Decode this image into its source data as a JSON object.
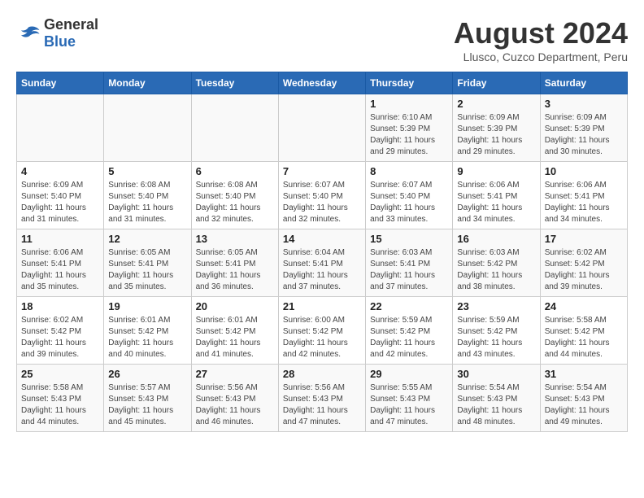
{
  "header": {
    "logo_general": "General",
    "logo_blue": "Blue",
    "month_year": "August 2024",
    "location": "Llusco, Cuzco Department, Peru"
  },
  "days_of_week": [
    "Sunday",
    "Monday",
    "Tuesday",
    "Wednesday",
    "Thursday",
    "Friday",
    "Saturday"
  ],
  "weeks": [
    [
      {
        "day": "",
        "info": ""
      },
      {
        "day": "",
        "info": ""
      },
      {
        "day": "",
        "info": ""
      },
      {
        "day": "",
        "info": ""
      },
      {
        "day": "1",
        "info": "Sunrise: 6:10 AM\nSunset: 5:39 PM\nDaylight: 11 hours\nand 29 minutes."
      },
      {
        "day": "2",
        "info": "Sunrise: 6:09 AM\nSunset: 5:39 PM\nDaylight: 11 hours\nand 29 minutes."
      },
      {
        "day": "3",
        "info": "Sunrise: 6:09 AM\nSunset: 5:39 PM\nDaylight: 11 hours\nand 30 minutes."
      }
    ],
    [
      {
        "day": "4",
        "info": "Sunrise: 6:09 AM\nSunset: 5:40 PM\nDaylight: 11 hours\nand 31 minutes."
      },
      {
        "day": "5",
        "info": "Sunrise: 6:08 AM\nSunset: 5:40 PM\nDaylight: 11 hours\nand 31 minutes."
      },
      {
        "day": "6",
        "info": "Sunrise: 6:08 AM\nSunset: 5:40 PM\nDaylight: 11 hours\nand 32 minutes."
      },
      {
        "day": "7",
        "info": "Sunrise: 6:07 AM\nSunset: 5:40 PM\nDaylight: 11 hours\nand 32 minutes."
      },
      {
        "day": "8",
        "info": "Sunrise: 6:07 AM\nSunset: 5:40 PM\nDaylight: 11 hours\nand 33 minutes."
      },
      {
        "day": "9",
        "info": "Sunrise: 6:06 AM\nSunset: 5:41 PM\nDaylight: 11 hours\nand 34 minutes."
      },
      {
        "day": "10",
        "info": "Sunrise: 6:06 AM\nSunset: 5:41 PM\nDaylight: 11 hours\nand 34 minutes."
      }
    ],
    [
      {
        "day": "11",
        "info": "Sunrise: 6:06 AM\nSunset: 5:41 PM\nDaylight: 11 hours\nand 35 minutes."
      },
      {
        "day": "12",
        "info": "Sunrise: 6:05 AM\nSunset: 5:41 PM\nDaylight: 11 hours\nand 35 minutes."
      },
      {
        "day": "13",
        "info": "Sunrise: 6:05 AM\nSunset: 5:41 PM\nDaylight: 11 hours\nand 36 minutes."
      },
      {
        "day": "14",
        "info": "Sunrise: 6:04 AM\nSunset: 5:41 PM\nDaylight: 11 hours\nand 37 minutes."
      },
      {
        "day": "15",
        "info": "Sunrise: 6:03 AM\nSunset: 5:41 PM\nDaylight: 11 hours\nand 37 minutes."
      },
      {
        "day": "16",
        "info": "Sunrise: 6:03 AM\nSunset: 5:42 PM\nDaylight: 11 hours\nand 38 minutes."
      },
      {
        "day": "17",
        "info": "Sunrise: 6:02 AM\nSunset: 5:42 PM\nDaylight: 11 hours\nand 39 minutes."
      }
    ],
    [
      {
        "day": "18",
        "info": "Sunrise: 6:02 AM\nSunset: 5:42 PM\nDaylight: 11 hours\nand 39 minutes."
      },
      {
        "day": "19",
        "info": "Sunrise: 6:01 AM\nSunset: 5:42 PM\nDaylight: 11 hours\nand 40 minutes."
      },
      {
        "day": "20",
        "info": "Sunrise: 6:01 AM\nSunset: 5:42 PM\nDaylight: 11 hours\nand 41 minutes."
      },
      {
        "day": "21",
        "info": "Sunrise: 6:00 AM\nSunset: 5:42 PM\nDaylight: 11 hours\nand 42 minutes."
      },
      {
        "day": "22",
        "info": "Sunrise: 5:59 AM\nSunset: 5:42 PM\nDaylight: 11 hours\nand 42 minutes."
      },
      {
        "day": "23",
        "info": "Sunrise: 5:59 AM\nSunset: 5:42 PM\nDaylight: 11 hours\nand 43 minutes."
      },
      {
        "day": "24",
        "info": "Sunrise: 5:58 AM\nSunset: 5:42 PM\nDaylight: 11 hours\nand 44 minutes."
      }
    ],
    [
      {
        "day": "25",
        "info": "Sunrise: 5:58 AM\nSunset: 5:43 PM\nDaylight: 11 hours\nand 44 minutes."
      },
      {
        "day": "26",
        "info": "Sunrise: 5:57 AM\nSunset: 5:43 PM\nDaylight: 11 hours\nand 45 minutes."
      },
      {
        "day": "27",
        "info": "Sunrise: 5:56 AM\nSunset: 5:43 PM\nDaylight: 11 hours\nand 46 minutes."
      },
      {
        "day": "28",
        "info": "Sunrise: 5:56 AM\nSunset: 5:43 PM\nDaylight: 11 hours\nand 47 minutes."
      },
      {
        "day": "29",
        "info": "Sunrise: 5:55 AM\nSunset: 5:43 PM\nDaylight: 11 hours\nand 47 minutes."
      },
      {
        "day": "30",
        "info": "Sunrise: 5:54 AM\nSunset: 5:43 PM\nDaylight: 11 hours\nand 48 minutes."
      },
      {
        "day": "31",
        "info": "Sunrise: 5:54 AM\nSunset: 5:43 PM\nDaylight: 11 hours\nand 49 minutes."
      }
    ]
  ]
}
